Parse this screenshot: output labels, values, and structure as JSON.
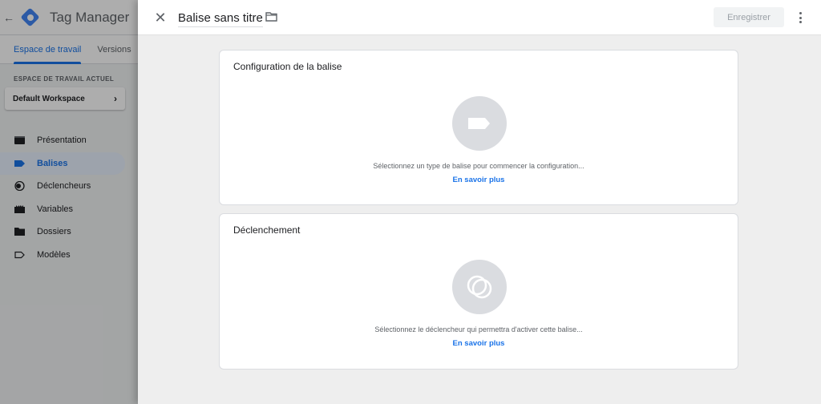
{
  "app": {
    "title": "Tag Manager",
    "tabs": [
      "Espace de travail",
      "Versions"
    ],
    "workspace_section_label": "ESPACE DE TRAVAIL ACTUEL",
    "workspace_name": "Default Workspace",
    "nav": [
      {
        "label": "Présentation",
        "icon": "overview-icon"
      },
      {
        "label": "Balises",
        "icon": "tag-icon",
        "active": true
      },
      {
        "label": "Déclencheurs",
        "icon": "trigger-icon"
      },
      {
        "label": "Variables",
        "icon": "variables-icon"
      },
      {
        "label": "Dossiers",
        "icon": "folder-icon"
      },
      {
        "label": "Modèles",
        "icon": "templates-icon"
      }
    ]
  },
  "panel": {
    "title": "Balise sans titre",
    "save_label": "Enregistrer",
    "cards": [
      {
        "title": "Configuration de la balise",
        "hint": "Sélectionnez un type de balise pour commencer la configuration...",
        "link": "En savoir plus"
      },
      {
        "title": "Déclenchement",
        "hint": "Sélectionnez le déclencheur qui permettra d'activer cette balise...",
        "link": "En savoir plus"
      }
    ]
  },
  "colors": {
    "accent": "#1a73e8",
    "logo": "#4285f4",
    "placeholder_circle": "#dadce0"
  }
}
